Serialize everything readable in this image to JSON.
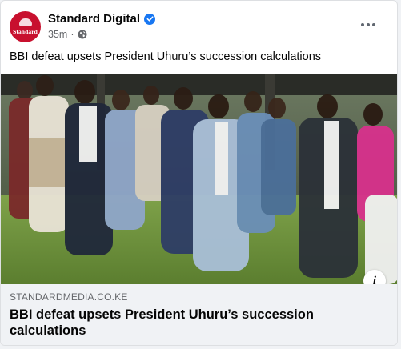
{
  "post": {
    "page_name": "Standard Digital",
    "timestamp": "35m",
    "separator": "·",
    "avatar_text": "Standard",
    "text": "BBI defeat upsets President Uhuru’s succession calculations",
    "verified_icon": "verified-badge-icon",
    "privacy_icon": "globe-icon"
  },
  "link": {
    "domain": "STANDARDMEDIA.CO.KE",
    "title": "BBI defeat upsets President Uhuru’s succession calculations"
  },
  "colors": {
    "brand_red": "#c8102e",
    "verified_blue": "#1877f2",
    "secondary_text": "#65676b"
  }
}
